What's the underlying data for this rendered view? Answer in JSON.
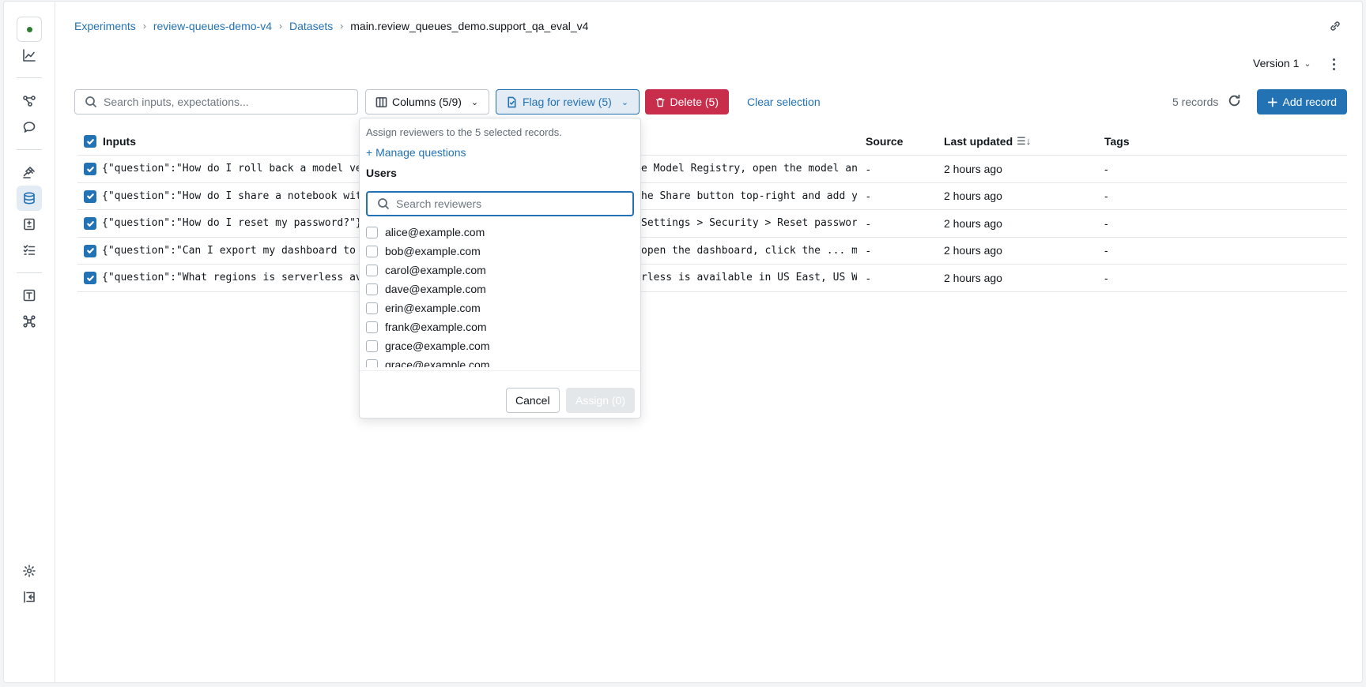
{
  "breadcrumb": {
    "experiments": "Experiments",
    "experiment": "review-queues-demo-v4",
    "datasets": "Datasets",
    "current": "main.review_queues_demo.support_qa_eval_v4",
    "separator": "›"
  },
  "header": {
    "version": "Version 1"
  },
  "toolbar": {
    "search_placeholder": "Search inputs, expectations...",
    "columns_label": "Columns (5/9)",
    "flag_label": "Flag for review (5)",
    "delete_label": "Delete (5)",
    "clear_label": "Clear selection",
    "records_count": "5 records",
    "add_label": "Add record"
  },
  "table": {
    "headers": {
      "inputs": "Inputs",
      "source": "Source",
      "last_updated": "Last updated",
      "tags": "Tags"
    },
    "rows": [
      {
        "inputs": "{\"question\":\"How do I roll back a model versi",
        "outputs": "e Model Registry, open the model and…",
        "source": "-",
        "updated": "2 hours ago",
        "tags": "-"
      },
      {
        "inputs": "{\"question\":\"How do I share a notebook with m",
        "outputs": "he Share button top-right and add yo…",
        "source": "-",
        "updated": "2 hours ago",
        "tags": "-"
      },
      {
        "inputs": "{\"question\":\"How do I reset my password?\"}",
        "outputs": " Settings > Security > Reset passwor…",
        "source": "-",
        "updated": "2 hours ago",
        "tags": "-"
      },
      {
        "inputs": "{\"question\":\"Can I export my dashboard to PDF",
        "outputs": "open the dashboard, click the ... me…",
        "source": "-",
        "updated": "2 hours ago",
        "tags": "-"
      },
      {
        "inputs": "{\"question\":\"What regions is serverless avail",
        "outputs": "rless is available in US East, US We…",
        "source": "-",
        "updated": "2 hours ago",
        "tags": "-"
      }
    ]
  },
  "popover": {
    "hint": "Assign reviewers to the 5 selected records.",
    "manage_questions": "+ Manage questions",
    "users_heading": "Users",
    "search_placeholder": "Search reviewers",
    "users": [
      "alice@example.com",
      "bob@example.com",
      "carol@example.com",
      "dave@example.com",
      "erin@example.com",
      "frank@example.com",
      "grace@example.com",
      "grace@example.com"
    ],
    "cancel_label": "Cancel",
    "assign_label": "Assign (0)"
  },
  "colors": {
    "accent": "#2272b4",
    "danger": "#c82d4c",
    "status_green": "#2e7d32"
  },
  "icons": {
    "sidebar": [
      "home-logo",
      "chart-icon",
      "traces-icon",
      "chat-icon",
      "judge-icon",
      "datasets-icon",
      "evaluation-icon",
      "checklist-icon",
      "prompts-icon",
      "agents-icon",
      "settings-icon",
      "collapse-sidebar-icon"
    ],
    "toolbar": [
      "search-icon",
      "columns-icon",
      "flag-review-icon",
      "trash-icon",
      "refresh-icon",
      "plus-icon",
      "link-icon",
      "kebab-menu-icon"
    ]
  }
}
